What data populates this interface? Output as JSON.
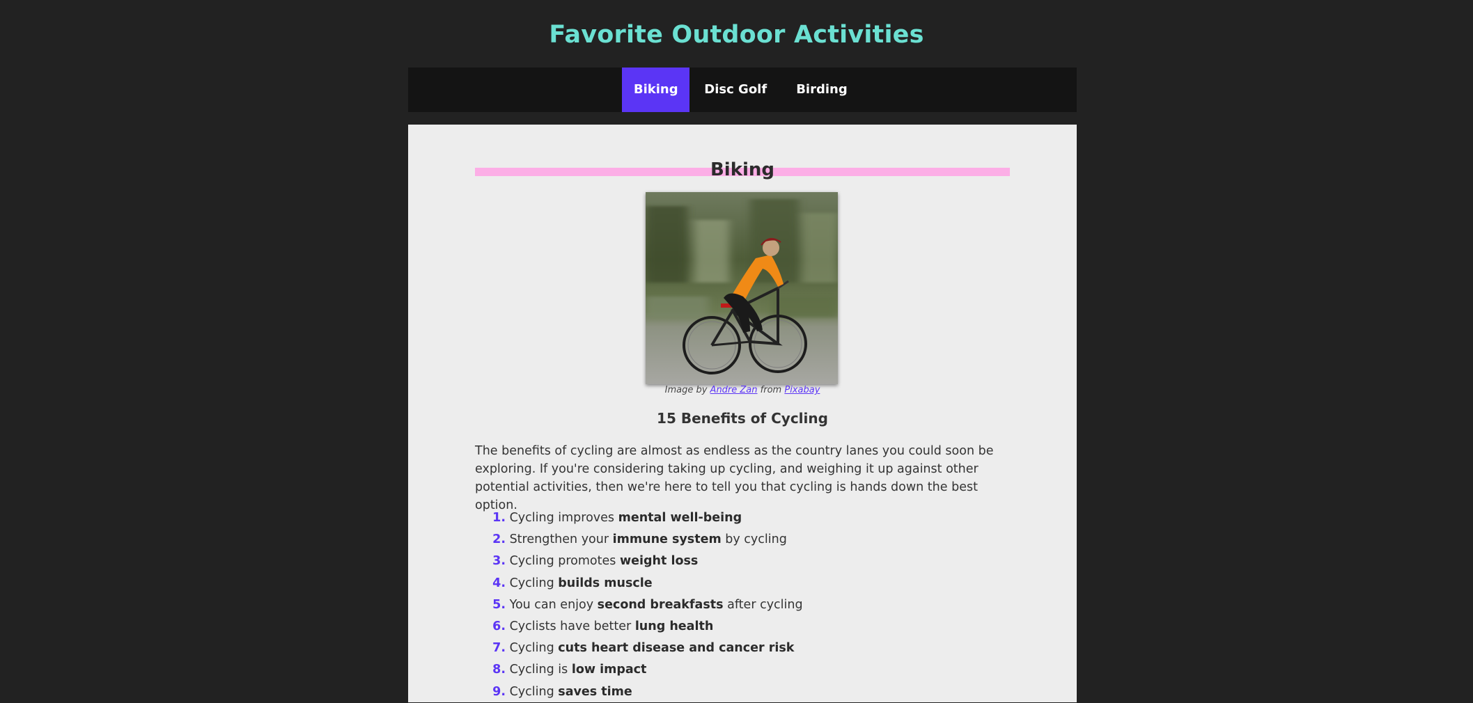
{
  "site": {
    "title": "Favorite Outdoor Activities"
  },
  "nav": {
    "items": [
      {
        "label": "Biking",
        "active": true
      },
      {
        "label": "Disc Golf",
        "active": false
      },
      {
        "label": "Birding",
        "active": false
      }
    ]
  },
  "colors": {
    "page_bg": "#222222",
    "title": "#6be0d2",
    "nav_bg": "#141414",
    "nav_active": "#5b35f5",
    "panel_bg": "#ededed",
    "heading_bar": "#fcaee6",
    "list_number": "#5b35f5"
  },
  "main": {
    "heading": "Biking",
    "image_alt": "Cyclist in orange jersey riding a road bike",
    "caption": {
      "prefix": "Image by",
      "author": "Andre Zan",
      "middle": "from",
      "source": "Pixabay"
    },
    "subheading": "15 Benefits of Cycling",
    "intro": "The benefits of cycling are almost as endless as the country lanes you could soon be exploring. If you're considering taking up cycling, and weighing it up against other potential activities, then we're here to tell you that cycling is hands down the best option.",
    "benefits": [
      {
        "num": "1.",
        "pre": "Cycling improves",
        "bold": "mental well-being",
        "post": ""
      },
      {
        "num": "2.",
        "pre": "Strengthen your",
        "bold": "immune system",
        "post": "by cycling"
      },
      {
        "num": "3.",
        "pre": "Cycling promotes",
        "bold": "weight loss",
        "post": ""
      },
      {
        "num": "4.",
        "pre": "Cycling",
        "bold": "builds muscle",
        "post": ""
      },
      {
        "num": "5.",
        "pre": "You can enjoy",
        "bold": "second breakfasts",
        "post": "after cycling"
      },
      {
        "num": "6.",
        "pre": "Cyclists have better",
        "bold": "lung health",
        "post": ""
      },
      {
        "num": "7.",
        "pre": "Cycling",
        "bold": "cuts heart disease and cancer risk",
        "post": ""
      },
      {
        "num": "8.",
        "pre": "Cycling is",
        "bold": "low impact",
        "post": ""
      },
      {
        "num": "9.",
        "pre": "Cycling",
        "bold": "saves time",
        "post": ""
      }
    ]
  }
}
